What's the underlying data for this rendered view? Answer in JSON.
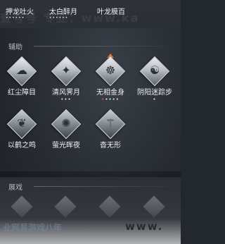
{
  "top_bar": {
    "items": [
      {
        "name": "押龙吐火",
        "dots": "••••••"
      },
      {
        "name": "太白醉月",
        "dots": "••••••"
      },
      {
        "name": "叶龙膜百",
        "dots": ""
      }
    ],
    "watermark": "查号号 专业：www.ka"
  },
  "sections": {
    "auxiliary": {
      "title": "辅助"
    },
    "other": {
      "title": "展戏"
    }
  },
  "skills": [
    {
      "name": "红尘障目",
      "glyph": "☁",
      "dots": "",
      "upgradable": false
    },
    {
      "name": "清风霁月",
      "glyph": "✦",
      "dots": "•••",
      "upgradable": false
    },
    {
      "name": "无相金身",
      "glyph": "☸",
      "dots": "•••••",
      "dots_red": 1,
      "upgradable": true
    },
    {
      "name": "阴阳迷踪步",
      "glyph": "☯",
      "dots": "•",
      "upgradable": false
    },
    {
      "name": "以鹤之鸣",
      "glyph": "❦",
      "dots": "",
      "upgradable": false
    },
    {
      "name": "萤光晖夜",
      "glyph": "✺",
      "dots": "",
      "upgradable": false
    },
    {
      "name": "杳无形",
      "glyph": "⚚",
      "dots": "",
      "upgradable": false
    }
  ],
  "watermark_bottom": {
    "left": "业网易游戏八年",
    "right": "www."
  }
}
